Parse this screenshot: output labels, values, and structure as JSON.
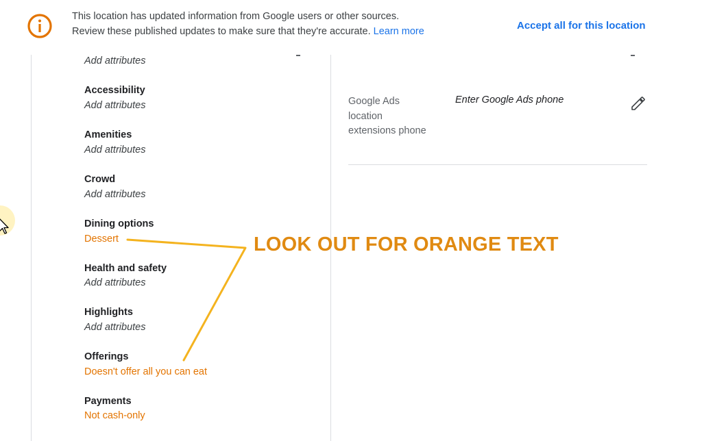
{
  "banner": {
    "line1": "This location has updated information from Google users or other sources.",
    "line2_text": "Review these published updates to make sure that they're accurate.",
    "learn_more": "Learn more",
    "accept_all": "Accept all for this location",
    "icon": "info-icon",
    "icon_color": "#e37400",
    "link_color": "#1a73e8"
  },
  "attributes": {
    "first_value": "Add attributes",
    "items": [
      {
        "title": "Accessibility",
        "value": "Add attributes"
      },
      {
        "title": "Amenities",
        "value": "Add attributes"
      },
      {
        "title": "Crowd",
        "value": "Add attributes"
      },
      {
        "title": "Dining options",
        "value": "Dessert"
      },
      {
        "title": "Health and safety",
        "value": "Add attributes"
      },
      {
        "title": "Highlights",
        "value": "Add attributes"
      },
      {
        "title": "Offerings",
        "value": "Doesn't offer all you can eat"
      },
      {
        "title": "Payments",
        "value": "Not cash-only"
      }
    ],
    "updated_color": "#e37400"
  },
  "right_panel": {
    "phone_label_lines": [
      "Google Ads",
      "location",
      "extensions phone"
    ],
    "phone_value": "Enter Google Ads phone",
    "edit_icon": "pencil-icon"
  },
  "annotation": {
    "text": "LOOK OUT FOR ORANGE TEXT",
    "color": "#e08a12"
  }
}
